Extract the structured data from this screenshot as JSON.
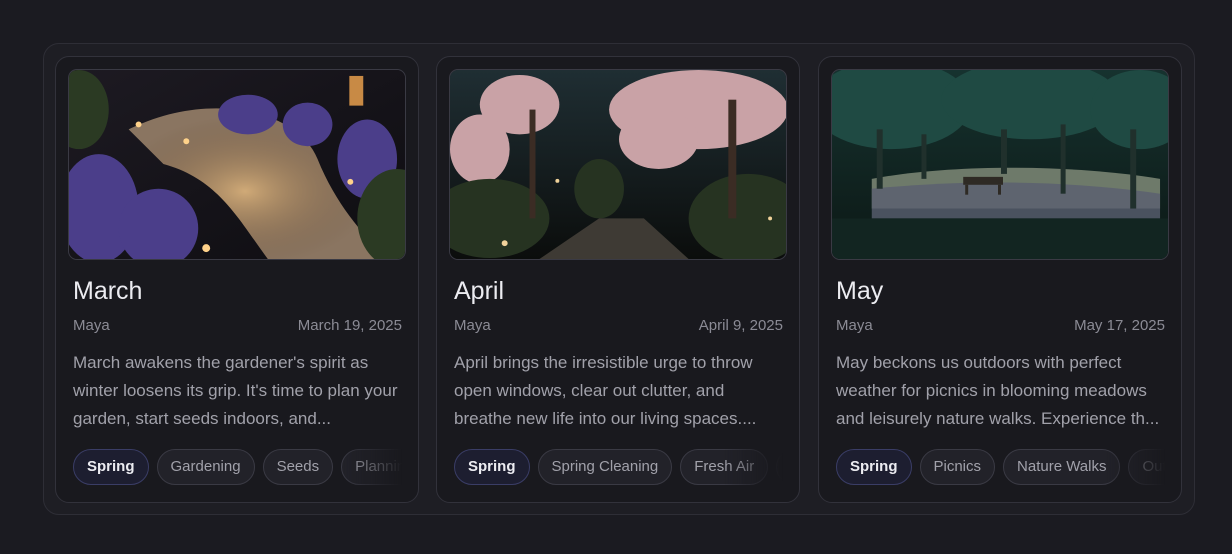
{
  "cards": [
    {
      "title": "March",
      "author": "Maya",
      "date": "March 19, 2025",
      "excerpt": "March awakens the gardener's spirit as winter loosens its grip. It's time to plan your garden, start seeds indoors, and...",
      "tags": [
        "Spring",
        "Gardening",
        "Seeds",
        "Planning"
      ],
      "image_subject": "garden path with hyacinths at night"
    },
    {
      "title": "April",
      "author": "Maya",
      "date": "April 9, 2025",
      "excerpt": "April brings the irresistible urge to throw open windows, clear out clutter, and breathe new life into our living spaces....",
      "tags": [
        "Spring",
        "Spring Cleaning",
        "Fresh Air",
        ""
      ],
      "image_subject": "cherry blossom avenue at night"
    },
    {
      "title": "May",
      "author": "Maya",
      "date": "May 17, 2025",
      "excerpt": "May beckons us outdoors with perfect weather for picnics in blooming meadows and leisurely nature walks. Experience th...",
      "tags": [
        "Spring",
        "Picnics",
        "Nature Walks",
        "Outdoors"
      ],
      "image_subject": "park with bench under trees"
    }
  ],
  "colors": {
    "background": "#1b1b21",
    "card": "#19191e",
    "active_tag": "#1d1e30"
  }
}
